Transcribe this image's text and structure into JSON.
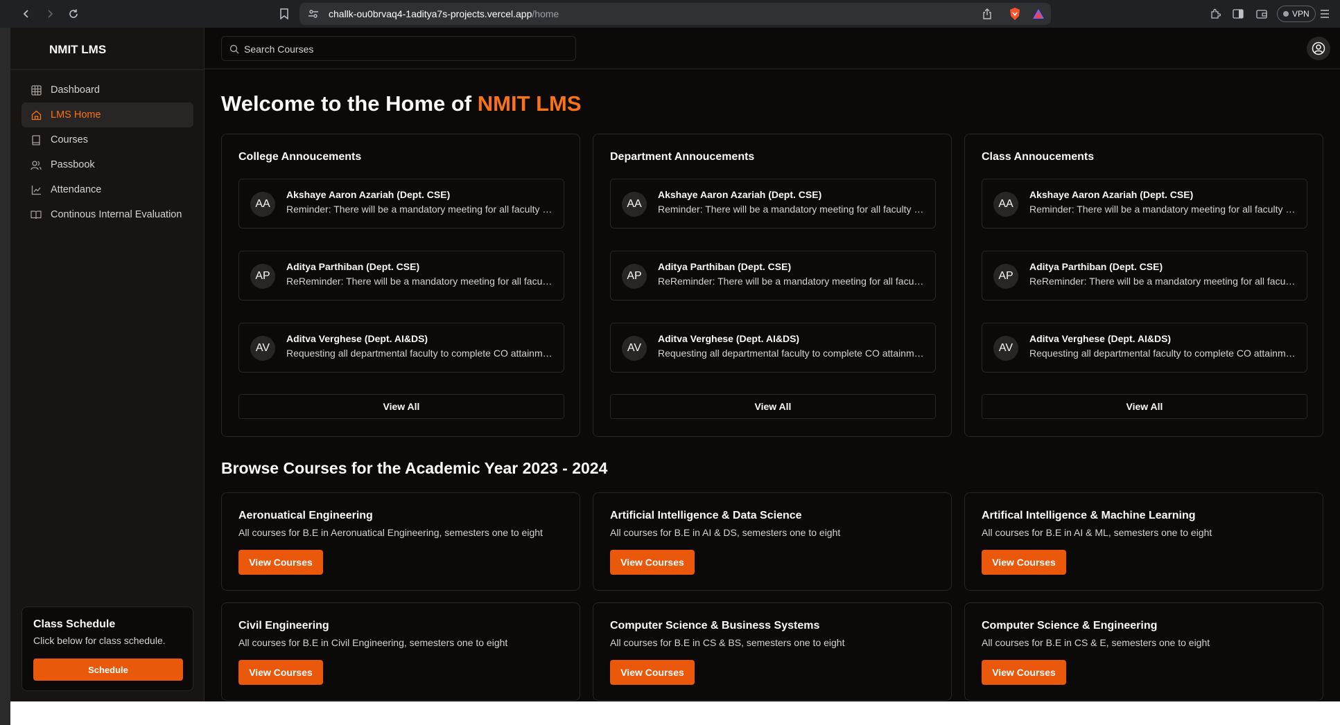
{
  "browser": {
    "url_host": "challk-ou0brvaq4-1aditya7s-projects.vercel.app",
    "url_path": "/home",
    "vpn_label": "VPN"
  },
  "app": {
    "brand": "NMIT LMS",
    "accent_color": "#f97316",
    "search_placeholder": "Search Courses"
  },
  "sidebar": {
    "items": [
      {
        "label": "Dashboard",
        "icon": "grid-icon",
        "active": false
      },
      {
        "label": "LMS Home",
        "icon": "home-icon",
        "active": true
      },
      {
        "label": "Courses",
        "icon": "book-icon",
        "active": false
      },
      {
        "label": "Passbook",
        "icon": "users-icon",
        "active": false
      },
      {
        "label": "Attendance",
        "icon": "chart-line-icon",
        "active": false
      },
      {
        "label": "Continous Internal Evaluation",
        "icon": "book-open-icon",
        "active": false
      }
    ],
    "schedule": {
      "title": "Class Schedule",
      "description": "Click below for class schedule.",
      "button": "Schedule"
    }
  },
  "main": {
    "welcome_prefix": "Welcome to the Home of ",
    "welcome_highlight": "NMIT LMS",
    "announcement_cards": [
      {
        "title": "College Annoucements",
        "items": [
          {
            "initials": "AA",
            "name": "Akshaye Aaron Azariah (Dept. CSE)",
            "message": "Reminder: There will be a mandatory meeting for all faculty members"
          },
          {
            "initials": "AP",
            "name": "Aditya Parthiban (Dept. CSE)",
            "message": "ReReminder: There will be a mandatory meeting for all faculty members"
          },
          {
            "initials": "AV",
            "name": "Aditva Verghese (Dept. AI&DS)",
            "message": "Requesting all departmental faculty to complete CO attainment"
          }
        ],
        "view_all": "View All"
      },
      {
        "title": "Department Annoucements",
        "items": [
          {
            "initials": "AA",
            "name": "Akshaye Aaron Azariah (Dept. CSE)",
            "message": "Reminder: There will be a mandatory meeting for all faculty members"
          },
          {
            "initials": "AP",
            "name": "Aditya Parthiban (Dept. CSE)",
            "message": "ReReminder: There will be a mandatory meeting for all faculty members"
          },
          {
            "initials": "AV",
            "name": "Aditva Verghese (Dept. AI&DS)",
            "message": "Requesting all departmental faculty to complete CO attainment"
          }
        ],
        "view_all": "View All"
      },
      {
        "title": "Class Annoucements",
        "items": [
          {
            "initials": "AA",
            "name": "Akshaye Aaron Azariah (Dept. CSE)",
            "message": "Reminder: There will be a mandatory meeting for all faculty members"
          },
          {
            "initials": "AP",
            "name": "Aditya Parthiban (Dept. CSE)",
            "message": "ReReminder: There will be a mandatory meeting for all faculty members"
          },
          {
            "initials": "AV",
            "name": "Aditva Verghese (Dept. AI&DS)",
            "message": "Requesting all departmental faculty to complete CO attainment"
          }
        ],
        "view_all": "View All"
      }
    ],
    "browse_title": "Browse Courses for the Academic Year 2023 - 2024",
    "courses": [
      {
        "name": "Aeronuatical Engineering",
        "description": "All courses for B.E in Aeronuatical Engineering, semesters one to eight",
        "button": "View Courses"
      },
      {
        "name": "Artificial Intelligence & Data Science",
        "description": "All courses for B.E in AI & DS, semesters one to eight",
        "button": "View Courses"
      },
      {
        "name": "Artifical Intelligence & Machine Learning",
        "description": "All courses for B.E in AI & ML, semesters one to eight",
        "button": "View Courses"
      },
      {
        "name": "Civil Engineering",
        "description": "All courses for B.E in Civil Engineering, semesters one to eight",
        "button": "View Courses"
      },
      {
        "name": "Computer Science & Business Systems",
        "description": "All courses for B.E in CS & BS, semesters one to eight",
        "button": "View Courses"
      },
      {
        "name": "Computer Science & Engineering",
        "description": "All courses for B.E in CS & E, semesters one to eight",
        "button": "View Courses"
      }
    ]
  }
}
